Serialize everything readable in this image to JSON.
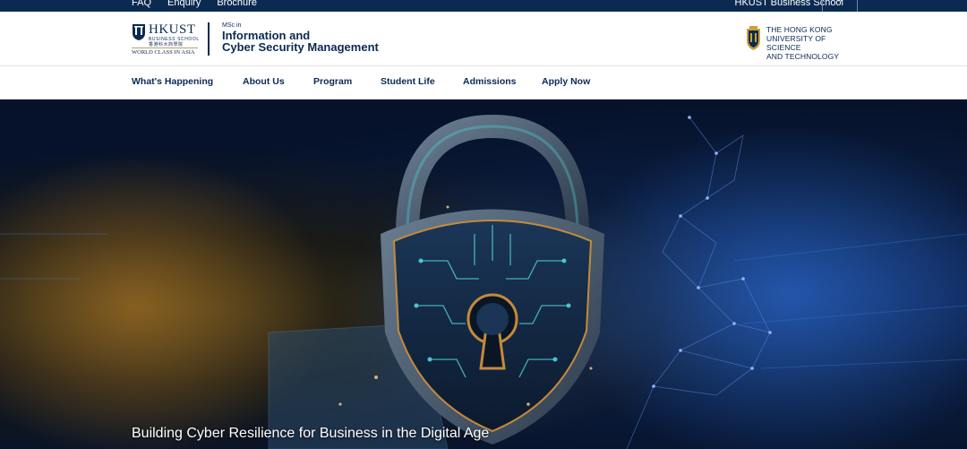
{
  "topbar": {
    "links": [
      "FAQ",
      "Enquiry",
      "Brochure"
    ],
    "school": "HKUST Business School",
    "toggle_icon": "chevron-up-icon"
  },
  "header": {
    "logo": {
      "name": "HKUST",
      "subtitle": "BUSINESS SCHOOL",
      "chinese": "香港科大商學院",
      "tagline": "WORLD CLASS IN ASIA"
    },
    "program": {
      "prefix": "MSc in",
      "line1": "Information and",
      "line2": "Cyber Security Management"
    },
    "university": {
      "line1": "THE HONG KONG",
      "line2": "UNIVERSITY OF SCIENCE",
      "line3": "AND TECHNOLOGY"
    }
  },
  "nav": {
    "items": [
      "What's Happening",
      "About Us",
      "Program",
      "Student Life",
      "Admissions",
      "Apply Now"
    ]
  },
  "hero": {
    "tagline": "Building Cyber Resilience for Business in the Digital Age",
    "image_icon": "shield-lock-icon"
  },
  "colors": {
    "brand_navy": "#0b2a52",
    "gold": "#b9a26b"
  }
}
